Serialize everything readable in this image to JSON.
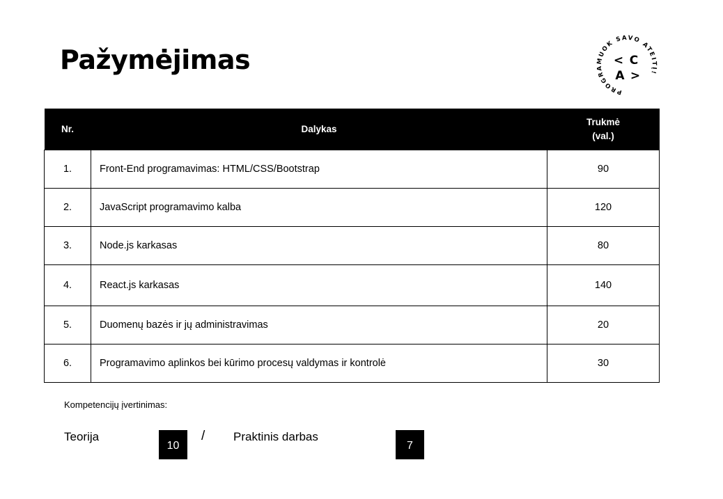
{
  "title": "Pažymėjimas",
  "logo": {
    "ring_text": "PROGRAMUOK SAVO ATEITĮ!",
    "row1_left": "<",
    "row1_right": "C",
    "row2_left": "A",
    "row2_right": ">"
  },
  "table": {
    "headers": {
      "nr": "Nr.",
      "subject": "Dalykas",
      "hours_line1": "Trukmė",
      "hours_line2": "(val.)"
    },
    "rows": [
      {
        "nr": "1.",
        "subject": "Front-End programavimas: HTML/CSS/Bootstrap",
        "hours": "90"
      },
      {
        "nr": "2.",
        "subject": "JavaScript programavimo kalba",
        "hours": "120"
      },
      {
        "nr": "3.",
        "subject": "Node.js karkasas",
        "hours": "80"
      },
      {
        "nr": "4.",
        "subject": "React.js karkasas",
        "hours": "140"
      },
      {
        "nr": "5.",
        "subject": "Duomenų bazės ir jų administravimas",
        "hours": "20"
      },
      {
        "nr": "6.",
        "subject": "Programavimo aplinkos bei kūrimo procesų valdymas ir kontrolė",
        "hours": "30"
      }
    ]
  },
  "assessment": {
    "label": "Kompetencijų įvertinimas:",
    "theory_label": "Teorija",
    "theory_score": "10",
    "separator": "/",
    "practice_label": "Praktinis darbas",
    "practice_score": "7"
  }
}
